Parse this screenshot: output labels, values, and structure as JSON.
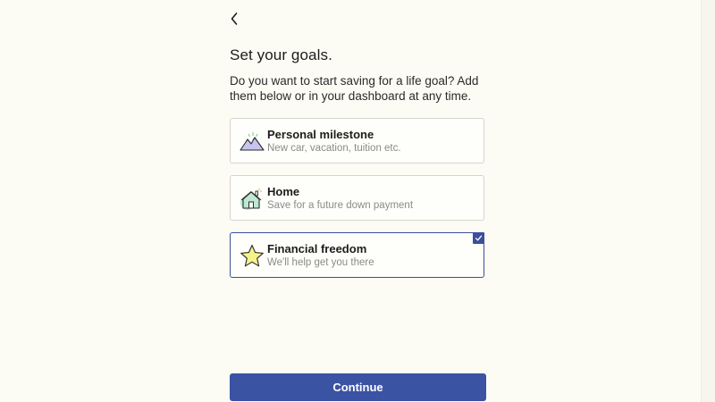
{
  "header": {
    "title": "Set your goals.",
    "subtitle": "Do you want to start saving for a life goal? Add them below or in your dashboard at any time."
  },
  "goals": [
    {
      "title": "Personal milestone",
      "description": "New car, vacation, tuition etc.",
      "icon": "mountain-icon",
      "selected": false
    },
    {
      "title": "Home",
      "description": "Save for a future down payment",
      "icon": "house-icon",
      "selected": false
    },
    {
      "title": "Financial freedom",
      "description": "We'll help get you there",
      "icon": "star-icon",
      "selected": true
    }
  ],
  "footer": {
    "continue_label": "Continue"
  },
  "colors": {
    "background": "#fdfcf4",
    "accent": "#3b53a3",
    "card_border": "#d4d4d0",
    "muted_text": "#8a8a8a"
  }
}
